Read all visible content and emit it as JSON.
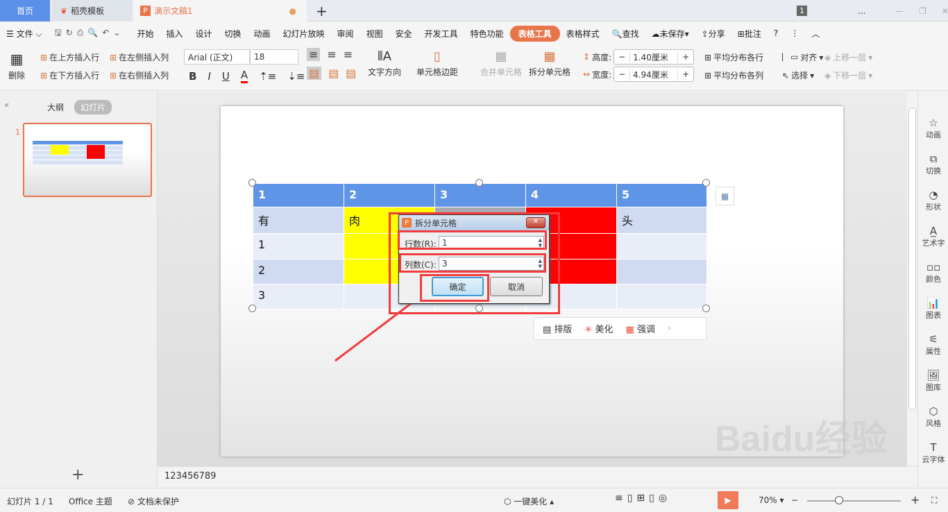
{
  "tabs": {
    "home": "首页",
    "template": "稻壳模板",
    "doc": "演示文稿1",
    "new": "+",
    "badge": "1",
    "more": "..."
  },
  "menu": {
    "file": "文件",
    "items": [
      "开始",
      "插入",
      "设计",
      "切换",
      "动画",
      "幻灯片放映",
      "审阅",
      "视图",
      "安全",
      "开发工具",
      "特色功能"
    ],
    "active": "表格工具",
    "next": "表格样式",
    "search": "查找",
    "unsaved": "未保存",
    "share": "分享",
    "comment": "批注",
    "help": "?"
  },
  "ribbon": {
    "delete": "删除",
    "insert_above": "在上方插入行",
    "insert_below": "在下方插入行",
    "insert_left": "在左侧插入列",
    "insert_right": "在右侧插入列",
    "font": "Arial (正文)",
    "size": "18",
    "bold": "B",
    "italic": "I",
    "underline": "U",
    "fontcolor": "A",
    "text_dir": "文字方向",
    "cell_margin": "单元格边距",
    "merge": "合并单元格",
    "split": "拆分单元格",
    "height_label": "高度:",
    "height_val": "1.40厘米",
    "width_label": "宽度:",
    "width_val": "4.94厘米",
    "dist_rows": "平均分布各行",
    "dist_cols": "平均分布各列",
    "align": "对齐",
    "select": "选择",
    "up": "上移一层",
    "down": "下移一层"
  },
  "left": {
    "outline": "大纲",
    "slides": "幻灯片",
    "slide_num": "1",
    "add": "+"
  },
  "table": {
    "header": [
      "1",
      "2",
      "3",
      "4",
      "5"
    ],
    "rows": [
      [
        "有",
        "肉",
        "",
        "",
        "头"
      ],
      [
        "1",
        "",
        "",
        "",
        ""
      ],
      [
        "2",
        "",
        "",
        "",
        ""
      ],
      [
        "3",
        "",
        "",
        "",
        ""
      ]
    ]
  },
  "float_bar": {
    "layout": "排版",
    "beautify": "美化",
    "emphasis": "强调"
  },
  "dialog": {
    "title": "拆分单元格",
    "rows_label": "行数(R):",
    "rows_val": "1",
    "cols_label": "列数(C):",
    "cols_val": "3",
    "ok": "确定",
    "cancel": "取消"
  },
  "notes": "123456789",
  "sidebar": [
    "动画",
    "切换",
    "形状",
    "艺术字",
    "颜色",
    "图表",
    "属性",
    "图库",
    "风格",
    "云字体"
  ],
  "status": {
    "slide": "幻灯片 1 / 1",
    "theme": "Office 主题",
    "protect": "文档未保护",
    "beautify": "一键美化",
    "zoom": "70%"
  },
  "colors": {
    "accent": "#e8744a",
    "header": "#5f95e6",
    "yellow": "#ffff00",
    "red": "#ff0000"
  }
}
